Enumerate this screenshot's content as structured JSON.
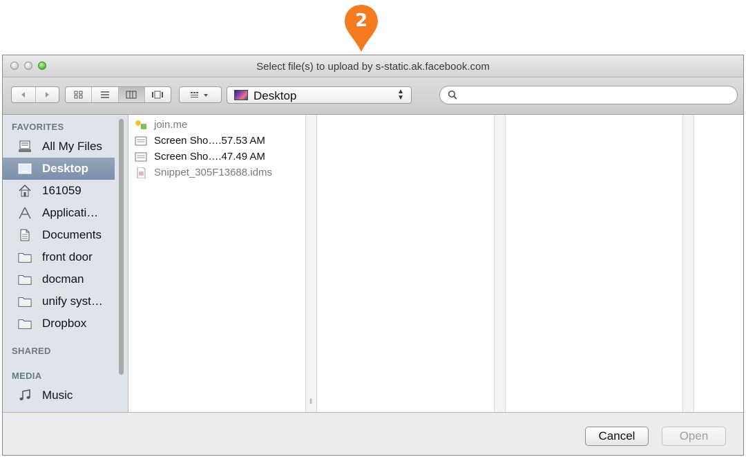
{
  "marker": {
    "number": "2",
    "color": "#f47b20"
  },
  "window": {
    "title": "Select file(s) to upload by s-static.ak.facebook.com"
  },
  "toolbar": {
    "back_icon": "chevron-left-icon",
    "forward_icon": "chevron-right-icon",
    "view_icons": [
      "icon-view-icon",
      "list-view-icon",
      "column-view-icon",
      "coverflow-view-icon"
    ],
    "active_view": "column-view-icon",
    "arrange_icon": "arrange-grid-icon",
    "location": "Desktop",
    "search": {
      "value": "",
      "placeholder": ""
    }
  },
  "sidebar": {
    "favorites_header": "FAVORITES",
    "favorites": [
      {
        "label": "All My Files",
        "icon": "all-files-icon"
      },
      {
        "label": "Desktop",
        "icon": "desktop-icon",
        "selected": true
      },
      {
        "label": "161059",
        "icon": "home-icon"
      },
      {
        "label": "Applicati…",
        "icon": "applications-icon"
      },
      {
        "label": "Documents",
        "icon": "documents-icon"
      },
      {
        "label": "front door",
        "icon": "folder-icon"
      },
      {
        "label": "docman",
        "icon": "folder-icon"
      },
      {
        "label": "unify syst…",
        "icon": "folder-icon"
      },
      {
        "label": "Dropbox",
        "icon": "folder-icon"
      }
    ],
    "shared_header": "SHARED",
    "media_header": "MEDIA",
    "media": [
      {
        "label": "Music",
        "icon": "music-note-icon"
      }
    ]
  },
  "files": [
    {
      "name": "join.me",
      "icon": "app-icon",
      "dim": true
    },
    {
      "name": "Screen Sho….57.53 AM",
      "icon": "image-file-icon",
      "dim": false
    },
    {
      "name": "Screen Sho….47.49 AM",
      "icon": "image-file-icon",
      "dim": false
    },
    {
      "name": "Snippet_305F13688.idms",
      "icon": "document-file-icon",
      "dim": true
    }
  ],
  "buttons": {
    "cancel": "Cancel",
    "open": "Open"
  }
}
